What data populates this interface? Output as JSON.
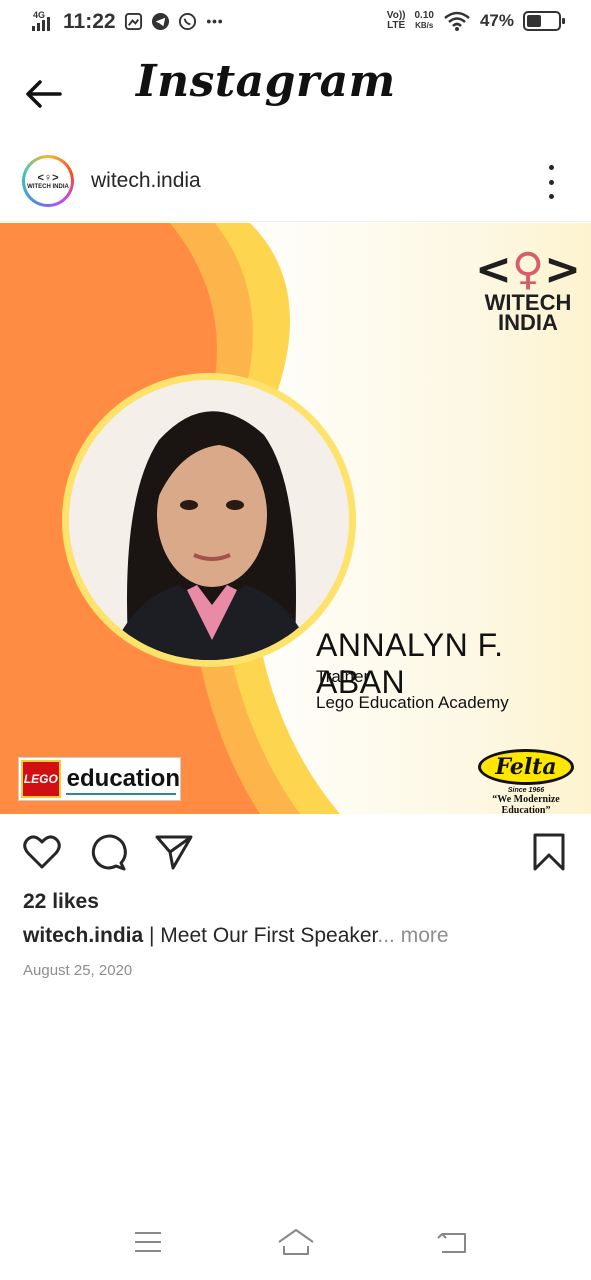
{
  "status_bar": {
    "network": "4G",
    "time": "11:22",
    "volte": "Vo))",
    "lte": "LTE",
    "speed_value": "0.10",
    "speed_unit": "KB/s",
    "battery_percent": "47%",
    "battery_level": 0.47
  },
  "header": {
    "title": "Instagram"
  },
  "post": {
    "username": "witech.india",
    "avatar_text": "WITECH INDIA",
    "image": {
      "brand_logo_text": "WITECH INDIA",
      "speaker_name": "ANNALYN F. ABAN",
      "speaker_role": "Trainer",
      "speaker_org": "Lego Education Academy",
      "lego_badge": "LEGO",
      "lego_text": "education",
      "felta_name": "Felta",
      "felta_since": "Since 1966",
      "felta_tagline": "“We Modernize Education”"
    },
    "likes": "22 likes",
    "caption_user": "witech.india",
    "caption_text": " | Meet Our First Speaker",
    "caption_ellipsis": "...",
    "caption_more": " more",
    "date": "August 25, 2020"
  },
  "icons": {
    "back": "arrow-left-icon",
    "more": "more-vertical-icon",
    "like": "heart-icon",
    "comment": "comment-icon",
    "share": "send-icon",
    "save": "bookmark-icon",
    "nav_menu": "menu-icon",
    "nav_home": "home-icon",
    "nav_back": "back-icon"
  },
  "colors": {
    "orange": "#ff8c42",
    "yellow": "#fde26b",
    "text": "#262626",
    "muted": "#8e8e8e"
  }
}
